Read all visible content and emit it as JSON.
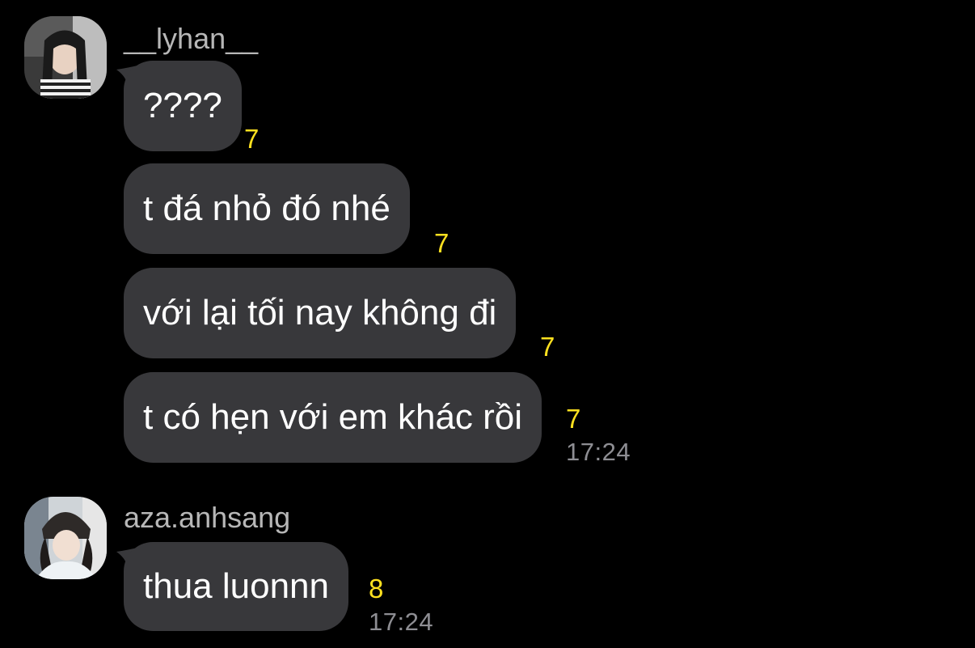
{
  "colors": {
    "background": "#000000",
    "bubble": "#38383b",
    "count": "#ffe11f",
    "time": "#8e8e93",
    "username": "#b7b7b7"
  },
  "groups": [
    {
      "username": "__lyhan__",
      "avatar": "avatar-lyhan",
      "messages": [
        {
          "text": "????",
          "count": "7"
        },
        {
          "text": "t đá nhỏ đó nhé",
          "count": "7"
        },
        {
          "text": "với lại tối nay không đi",
          "count": "7"
        },
        {
          "text": "t có hẹn với em khác rồi",
          "count": "7"
        }
      ],
      "time": "17:24"
    },
    {
      "username": "aza.anhsang",
      "avatar": "avatar-aza",
      "messages": [
        {
          "text": "thua luonnn",
          "count": "8"
        }
      ],
      "time": "17:24"
    }
  ]
}
